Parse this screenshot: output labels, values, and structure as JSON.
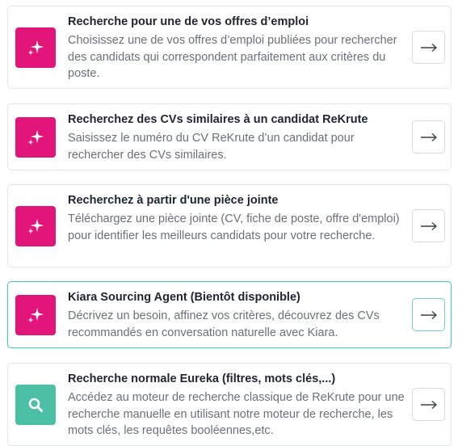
{
  "colors": {
    "magenta": "#e2157a",
    "teal": "#4cc0a5",
    "active_border": "#4ec7b5"
  },
  "options": [
    {
      "title": "Recherche pour une de vos offres d’emploi",
      "description": "Choisissez une de vos offres d’emploi publiées pour rechercher des candidats qui correspondent parfaitement aux critères du poste.",
      "icon": "sparkle-icon",
      "active": false
    },
    {
      "title": "Recherchez des CVs similaires à un candidat ReKrute",
      "description": "Saisissez le numéro du CV ReKrute d’un candidat pour rechercher des CVs similaires.",
      "icon": "sparkle-icon",
      "active": false
    },
    {
      "title": "Recherchez à partir d'une pièce jointe",
      "description": "Téléchargez une pièce jointe (CV, fiche de poste, offre d'emploi) pour identifier les meilleurs candidats pour votre recherche.",
      "icon": "sparkle-icon",
      "active": false
    },
    {
      "title": "Kiara Sourcing Agent (Bientôt disponible)",
      "description": "Décrivez un besoin, affinez vos critères, découvrez des CVs recommandés en conversation naturelle avec Kiara.",
      "icon": "sparkle-icon",
      "active": true
    },
    {
      "title": "Recherche normale Eureka (filtres, mots clés,...)",
      "description": "Accédez au moteur de recherche classique de ReKrute pour une recherche manuelle en utilisant notre moteur de recherche, les mots clés, les requêtes booléennes,etc.",
      "icon": "search-icon",
      "active": false
    }
  ],
  "arrow_glyph": "→"
}
